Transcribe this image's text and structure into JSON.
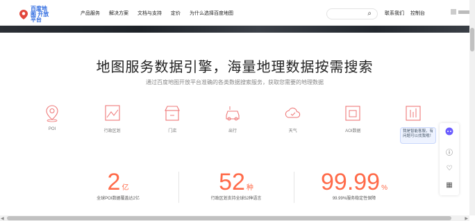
{
  "brand": {
    "logo_text": "百度地图 开放平台"
  },
  "nav": {
    "items": [
      "产品服务",
      "解决方案",
      "文档与支持",
      "定价",
      "为什么选择百度地图"
    ]
  },
  "search": {
    "placeholder": ""
  },
  "header_right": {
    "contact": "联系我们",
    "console": "控制台"
  },
  "hero": {
    "title": "地图服务数据引擎，海量地理数据按需搜索",
    "subtitle": "通过百度地图开放平台准确的各类数据搜索服务，获取您需要的地理数据"
  },
  "features": [
    {
      "label": "POI",
      "icon": "location-pin-icon"
    },
    {
      "label": "行政区划",
      "icon": "map-area-icon"
    },
    {
      "label": "门店",
      "icon": "store-icon"
    },
    {
      "label": "出行",
      "icon": "car-icon"
    },
    {
      "label": "天气",
      "icon": "weather-icon"
    },
    {
      "label": "AOI数据",
      "icon": "aoi-icon"
    },
    {
      "label": "",
      "icon": "chart-icon"
    }
  ],
  "stats": [
    {
      "value": "2",
      "unit": "亿",
      "desc": "全球POI数据覆盖达2亿"
    },
    {
      "value": "52",
      "unit": "种",
      "desc": "行政区划支持全球52种语言"
    },
    {
      "value": "99.99",
      "unit": "%",
      "desc": "99.99%服务稳定性保障"
    }
  ],
  "floating_tip": {
    "text": "我是智能客服，有问题可以找我哦！"
  },
  "colors": {
    "accent": "#ff6b4a",
    "brand": "#2f6be0"
  }
}
